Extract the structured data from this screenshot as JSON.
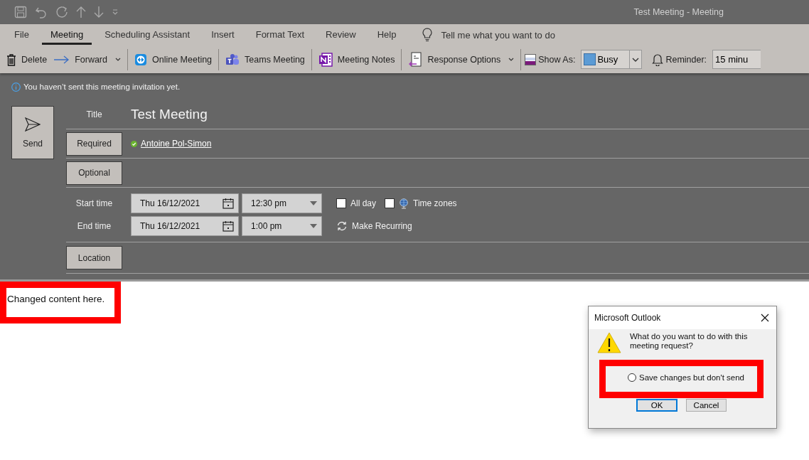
{
  "window": {
    "title": "Test Meeting  -  Meeting"
  },
  "ribbon_tabs": [
    {
      "label": "File",
      "selected": false
    },
    {
      "label": "Meeting",
      "selected": true
    },
    {
      "label": "Scheduling Assistant",
      "selected": false
    },
    {
      "label": "Insert",
      "selected": false
    },
    {
      "label": "Format Text",
      "selected": false
    },
    {
      "label": "Review",
      "selected": false
    },
    {
      "label": "Help",
      "selected": false
    }
  ],
  "tell_me": {
    "placeholder": "Tell me what you want to do"
  },
  "toolbar": {
    "groups": [
      [
        {
          "kind": "button",
          "label": "Delete"
        },
        {
          "kind": "dropdown",
          "label": "Forward"
        }
      ],
      [
        {
          "kind": "button",
          "label": "Online Meeting"
        }
      ],
      [
        {
          "kind": "button",
          "label": "Teams Meeting"
        }
      ],
      [
        {
          "kind": "button",
          "label": "Meeting Notes"
        }
      ],
      [
        {
          "kind": "dropdown",
          "label": "Response Options"
        }
      ],
      [
        {
          "kind": "label",
          "label": "Show As:"
        },
        {
          "kind": "combo",
          "label": "Busy",
          "color": "#5b9bd5"
        },
        {
          "kind": "label",
          "label": "Reminder:"
        },
        {
          "kind": "combo",
          "label": "15 minu"
        }
      ]
    ]
  },
  "info_bar": {
    "text": "You haven’t sent this meeting invitation yet."
  },
  "form": {
    "send_button": "Send",
    "title_label": "Title",
    "title_value": "Test Meeting",
    "required_button": "Required",
    "attendees": [
      {
        "name": "Antoine Pol-Simon"
      }
    ],
    "optional_button": "Optional",
    "start": {
      "label": "Start time",
      "date": "Thu 16/12/2021",
      "time": "12:30 pm"
    },
    "end": {
      "label": "End time",
      "date": "Thu 16/12/2021",
      "time": "1:00 pm"
    },
    "all_day": {
      "label": "All day",
      "checked": false
    },
    "time_zones": {
      "label": "Time zones",
      "checked": false
    },
    "make_recurring": "Make Recurring",
    "location_button": "Location"
  },
  "body": {
    "text": "Changed content here.",
    "highlighted": true
  },
  "dialog": {
    "title": "Microsoft Outlook",
    "message": "What do you want to do with this meeting request?",
    "options": [
      {
        "label": "Save changes but don't send",
        "selected": false
      }
    ],
    "highlighted": true,
    "buttons": [
      {
        "label": "OK",
        "default": true
      },
      {
        "label": "Cancel",
        "default": false
      }
    ]
  }
}
